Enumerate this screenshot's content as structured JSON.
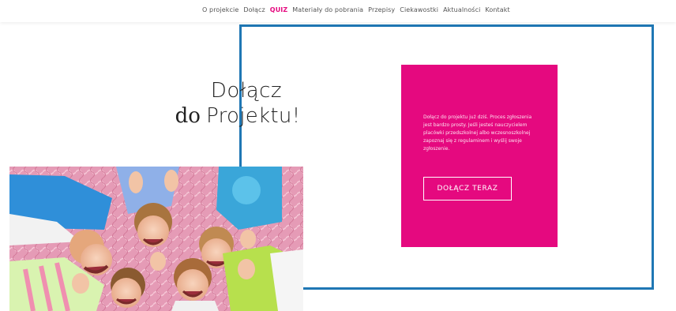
{
  "nav": {
    "items": [
      {
        "label": "O projekcie"
      },
      {
        "label": "Dołącz"
      },
      {
        "label": "QUIZ"
      },
      {
        "label": "Materiały do pobrania"
      },
      {
        "label": "Przepisy"
      },
      {
        "label": "Ciekawostki"
      },
      {
        "label": "Aktualności"
      },
      {
        "label": "Kontakt"
      }
    ],
    "active_index": 2
  },
  "hero": {
    "title_line1": "Dołącz",
    "title_line2_do": "do",
    "title_line2_rest": "Projektu!"
  },
  "photo": {
    "subject": "children-lying-in-circle"
  },
  "card": {
    "text": "Dołącz do projektu już dziś. Proces zgłoszenia jest bardzo prosty. Jeśli jesteś nauczycielem placówki przedszkolnej albo wczesnoszkolnej zapoznaj się z regulaminem i wyślij swoje zgłoszenie.",
    "button_label": "DOŁĄCZ TERAZ"
  },
  "colors": {
    "accent_pink": "#e5097f",
    "frame_blue": "#1f77b4",
    "text_dark": "#222222",
    "nav_text": "#555555"
  }
}
